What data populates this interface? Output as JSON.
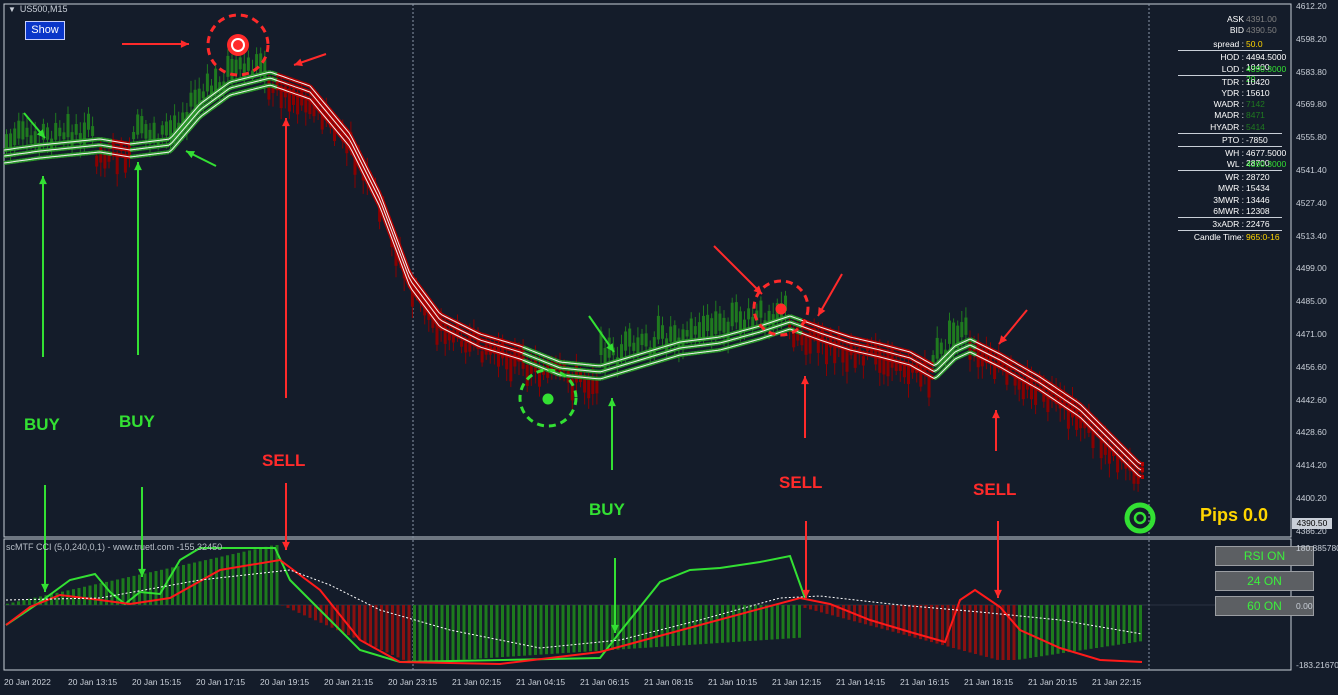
{
  "symbol": "US500,M15",
  "show_button": "Show",
  "signals": {
    "buy1": "BUY",
    "buy2": "BUY",
    "buy3": "BUY",
    "sell1": "SELL",
    "sell2": "SELL",
    "sell3": "SELL"
  },
  "pips": "Pips 0.0",
  "indicator_title": "scMTF CCI (5,0,240,0,1) - www.truetl.com -155.32450",
  "indicator_buttons": [
    "RSI ON",
    "24 ON",
    "60 ON"
  ],
  "price_axis": [
    "4612.20",
    "4598.20",
    "4583.80",
    "4569.80",
    "4555.80",
    "4541.40",
    "4527.40",
    "4513.40",
    "4499.00",
    "4485.00",
    "4471.00",
    "4456.60",
    "4442.60",
    "4428.60",
    "4414.20",
    "4400.20",
    "4386.20"
  ],
  "current_price": "4390.50",
  "indicator_axis": [
    "180.885780",
    "0.00",
    "-183.216700"
  ],
  "time_axis": [
    "20 Jan 2022",
    "20 Jan 13:15",
    "20 Jan 15:15",
    "20 Jan 17:15",
    "20 Jan 19:15",
    "20 Jan 21:15",
    "20 Jan 23:15",
    "21 Jan 02:15",
    "21 Jan 04:15",
    "21 Jan 06:15",
    "21 Jan 08:15",
    "21 Jan 10:15",
    "21 Jan 12:15",
    "21 Jan 14:15",
    "21 Jan 16:15",
    "21 Jan 18:15",
    "21 Jan 20:15",
    "21 Jan 22:15"
  ],
  "stats_panel": [
    {
      "k": "ASK",
      "v": "4391.00"
    },
    {
      "k": "BID",
      "v": "4390.50"
    },
    {
      "k": "spread :",
      "v": "50.0"
    },
    {
      "k": "HOD :",
      "v": "4494.5000   10400"
    },
    {
      "k": "LOD :",
      "v": "4390.3000   20"
    },
    {
      "k": "TDR :",
      "v": "10420"
    },
    {
      "k": "YDR :",
      "v": "15610"
    },
    {
      "k": "WADR :",
      "v": "7142"
    },
    {
      "k": "MADR :",
      "v": "8471"
    },
    {
      "k": "HYADR :",
      "v": "5414"
    },
    {
      "k": "PTO :",
      "v": "-7850"
    },
    {
      "k": "WH :",
      "v": "4677.5000   28700"
    },
    {
      "k": "WL :",
      "v": "4390.3000"
    },
    {
      "k": "WR :",
      "v": "28720"
    },
    {
      "k": "MWR :",
      "v": "15434"
    },
    {
      "k": "3MWR :",
      "v": "13446"
    },
    {
      "k": "6MWR :",
      "v": "12308"
    },
    {
      "k": "3xADR :",
      "v": "22476"
    },
    {
      "k": "Candle Time:",
      "v": "965:0-16"
    }
  ],
  "colors": {
    "bull": "#1f7a1f",
    "bear": "#a00000",
    "buy": "#33e033",
    "sell": "#ff2a2a",
    "pips": "#ffd500",
    "bg": "#141c2a"
  }
}
